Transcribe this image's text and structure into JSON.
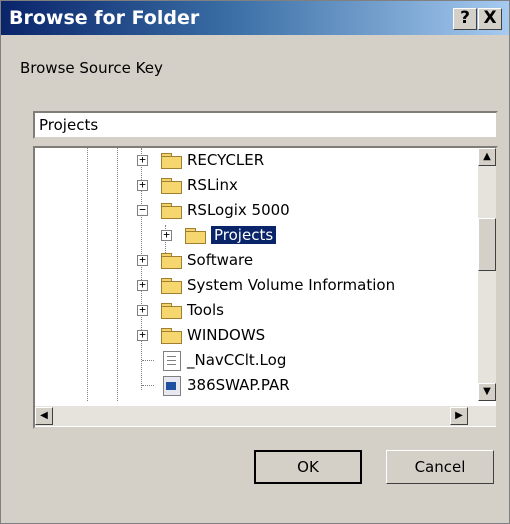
{
  "dialog": {
    "title": "Browse for Folder",
    "help_label": "?",
    "close_label": "X",
    "prompt": "Browse Source Key",
    "path_value": "Projects"
  },
  "tree": {
    "items": [
      {
        "label": "RECYCLER",
        "icon": "folder-icon",
        "expander": "+",
        "selected": false
      },
      {
        "label": "RSLinx",
        "icon": "folder-icon",
        "expander": "+",
        "selected": false
      },
      {
        "label": "RSLogix 5000",
        "icon": "folder-open-icon",
        "expander": "−",
        "selected": false
      },
      {
        "label": "Projects",
        "icon": "folder-open-icon",
        "expander": "+",
        "selected": true
      },
      {
        "label": "Software",
        "icon": "folder-icon",
        "expander": "+",
        "selected": false
      },
      {
        "label": "System Volume Information",
        "icon": "folder-icon",
        "expander": "+",
        "selected": false
      },
      {
        "label": "Tools",
        "icon": "folder-icon",
        "expander": "+",
        "selected": false
      },
      {
        "label": "WINDOWS",
        "icon": "folder-icon",
        "expander": "+",
        "selected": false
      },
      {
        "label": "_NavCClt.Log",
        "icon": "text-file-icon",
        "expander": "",
        "selected": false
      },
      {
        "label": "386SWAP.PAR",
        "icon": "system-file-icon",
        "expander": "",
        "selected": false
      }
    ]
  },
  "buttons": {
    "ok": "OK",
    "cancel": "Cancel"
  },
  "colors": {
    "titlebar_start": "#0a246a",
    "titlebar_end": "#a6caf0",
    "selection": "#0a246a",
    "face": "#d4d0c8"
  }
}
